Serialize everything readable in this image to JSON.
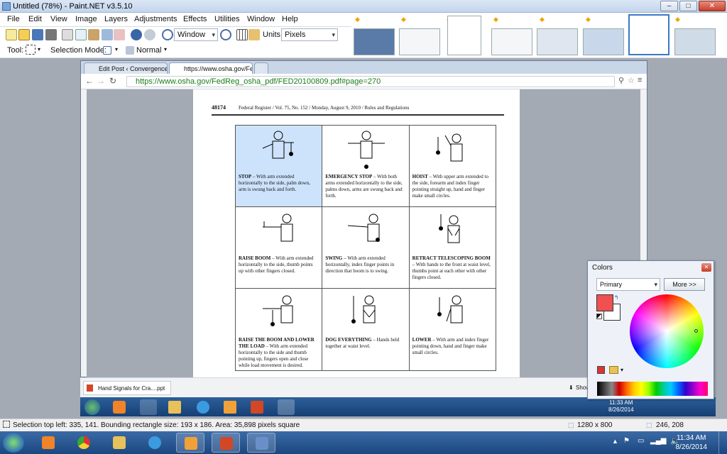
{
  "window": {
    "title": "Untitled (78%) - Paint.NET v3.5.10",
    "minimize": "–",
    "maximize": "□",
    "close": "✕"
  },
  "menu": [
    "File",
    "Edit",
    "View",
    "Image",
    "Layers",
    "Adjustments",
    "Effects",
    "Utilities",
    "Window",
    "Help"
  ],
  "toolbar": {
    "window_select": "Window",
    "units_label": "Units:",
    "units_select": "Pixels",
    "tool_label": "Tool:",
    "selection_mode_label": "Selection Mode:",
    "blend_select": "Normal"
  },
  "browser": {
    "tabs": [
      "Edit Post ‹ Convergence T",
      "https://www.osha.gov/Fe"
    ],
    "url": "https://www.osha.gov/FedReg_osha_pdf/FED20100809.pdf#page=270",
    "download_item": "Hand Signals for Cra....ppt",
    "show_all": "Show"
  },
  "pdf": {
    "header_page": "48174",
    "header_text": "Federal Register / Vol. 75, No. 152 / Monday, August 9, 2010 / Rules and Regulations",
    "cells": [
      {
        "title": "STOP",
        "text": " – With arm extended horizontally to the side, palm down, arm is swung back and forth."
      },
      {
        "title": "EMERGENCY STOP",
        "text": " – With both arms extended horizontally to the side, palms down, arms are swung back and forth."
      },
      {
        "title": "HOIST",
        "text": " – With upper arm extended to the side, forearm and index finger pointing straight up, hand and finger make small circles."
      },
      {
        "title": "RAISE BOOM",
        "text": " – With arm extended horizontally to the side, thumb points up with other fingers closed."
      },
      {
        "title": "SWING",
        "text": " – With arm extended horizontally, index finger points in direction that boom is to swing."
      },
      {
        "title": "RETRACT TELESCOPING BOOM",
        "text": " – With hands to the front at waist level, thumbs point at each other with other fingers closed."
      },
      {
        "title": "RAISE THE BOOM AND LOWER THE LOAD",
        "text": " – With arm extended horizontally to the side and thumb pointing up, fingers open and close while load movement is desired."
      },
      {
        "title": "DOG EVERYTHING",
        "text": " – Hands held together at waist level."
      },
      {
        "title": "LOWER",
        "text": " – With arm and index finger pointing down, hand and finger make small circles."
      }
    ]
  },
  "colors_window": {
    "title": "Colors",
    "mode_select": "Primary",
    "more_button": "More >>",
    "primary_color": "#f05050"
  },
  "inner_clock": {
    "time": "11:33 AM",
    "date": "8/26/2014"
  },
  "status": {
    "selection": "Selection top left: 335, 141. Bounding rectangle size: 193 x 186. Area: 35,898 pixels square",
    "image_size": "1280 x 800",
    "cursor": "246, 208"
  },
  "clock": {
    "time": "11:34 AM",
    "date": "8/26/2014"
  }
}
